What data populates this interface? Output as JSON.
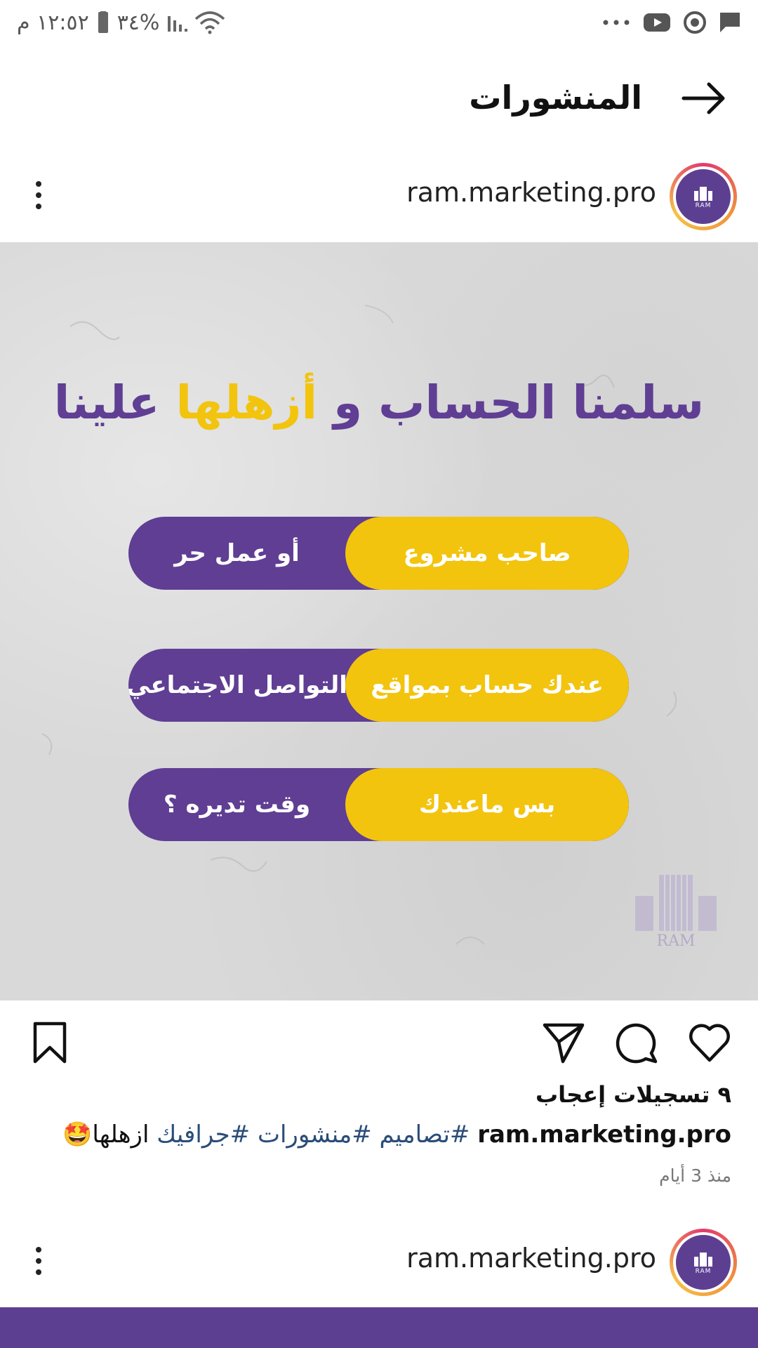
{
  "status_bar": {
    "time": "١٢:٥٢ م",
    "battery_percent": "٣٤%",
    "notification_icons": [
      "chat-icon",
      "chrome-icon",
      "youtube-icon",
      "more-dots-icon"
    ],
    "system_icons": [
      "battery-icon",
      "signal-icon",
      "wifi-icon"
    ]
  },
  "header": {
    "title": "المنشورات",
    "back_icon": "arrow-right-icon"
  },
  "post": {
    "username": "ram.marketing.pro",
    "avatar_text": "RAM",
    "image": {
      "headline_part1": "سلمنا الحساب و",
      "headline_accent": "أزهلها",
      "headline_part2": "علينا",
      "pills": [
        {
          "yellow_text": "صاحب مشروع",
          "purple_text": "أو عمل حر"
        },
        {
          "yellow_text": "عندك حساب بمواقع",
          "purple_text": "التواصل الاجتماعي"
        },
        {
          "yellow_text": "بس ماعندك",
          "purple_text": "وقت تديره ؟"
        }
      ],
      "watermark_text": "RAM",
      "colors": {
        "purple": "#5f3e93",
        "yellow": "#f2c40e"
      }
    },
    "likes": "٩ تسجيلات إعجاب",
    "caption": {
      "user": "ram.marketing.pro",
      "hashtags": [
        "#تصاميم",
        "#منشورات",
        "#جرافيك"
      ],
      "text": "ازهلها",
      "emoji": "🤩"
    },
    "time_ago": "منذ 3 أيام"
  },
  "next_post": {
    "username": "ram.marketing.pro",
    "avatar_text": "RAM"
  }
}
